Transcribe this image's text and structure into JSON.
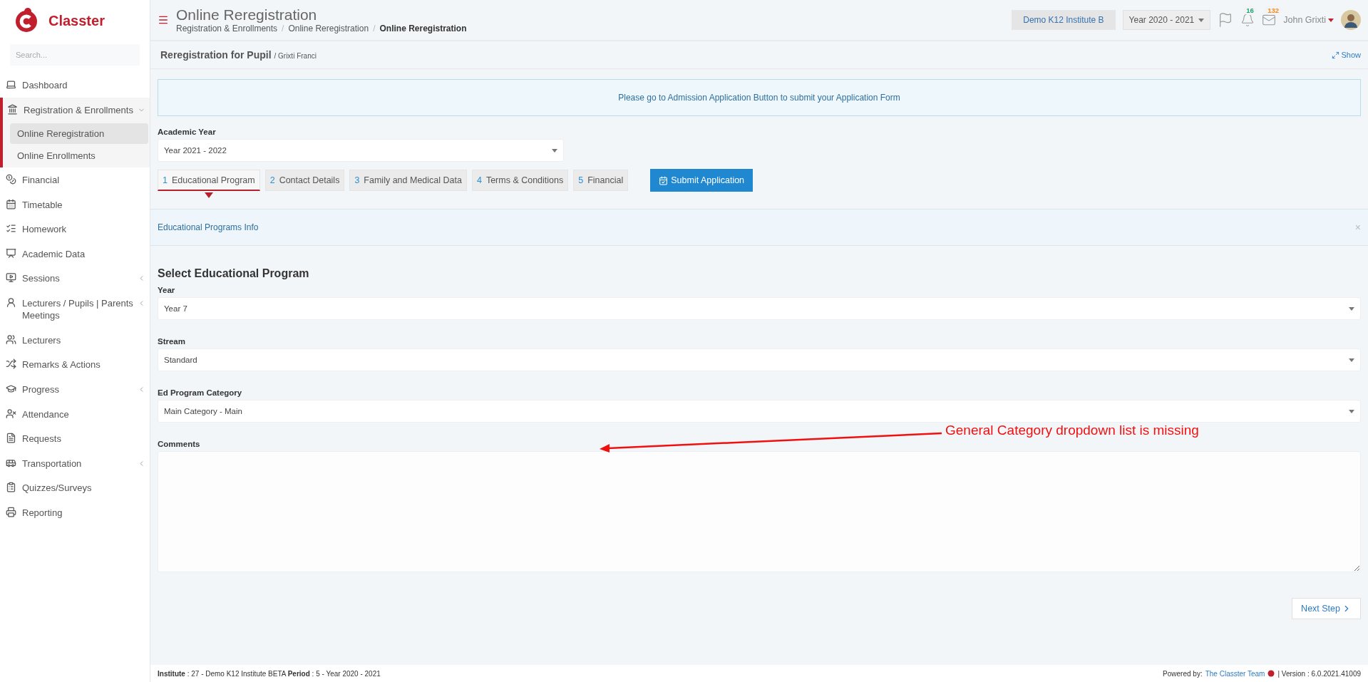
{
  "brand": {
    "name": "Classter"
  },
  "sidebar": {
    "search": {
      "placeholder": "Search..."
    },
    "items": [
      {
        "label": "Dashboard",
        "expandable": false,
        "expanded": false
      },
      {
        "label": "Registration & Enrollments",
        "expandable": true,
        "expanded": true,
        "children": [
          {
            "label": "Online Reregistration",
            "selected": true
          },
          {
            "label": "Online Enrollments",
            "selected": false
          }
        ]
      },
      {
        "label": "Financial",
        "expandable": false,
        "expanded": false
      },
      {
        "label": "Timetable",
        "expandable": false,
        "expanded": false
      },
      {
        "label": "Homework",
        "expandable": false,
        "expanded": false
      },
      {
        "label": "Academic Data",
        "expandable": false,
        "expanded": false
      },
      {
        "label": "Sessions",
        "expandable": true,
        "expanded": false
      },
      {
        "label": "Lecturers / Pupils | Parents Meetings",
        "expandable": true,
        "expanded": false
      },
      {
        "label": "Lecturers",
        "expandable": false,
        "expanded": false
      },
      {
        "label": "Remarks & Actions",
        "expandable": false,
        "expanded": false
      },
      {
        "label": "Progress",
        "expandable": true,
        "expanded": false
      },
      {
        "label": "Attendance",
        "expandable": false,
        "expanded": false
      },
      {
        "label": "Requests",
        "expandable": false,
        "expanded": false
      },
      {
        "label": "Transportation",
        "expandable": true,
        "expanded": false
      },
      {
        "label": "Quizzes/Surveys",
        "expandable": false,
        "expanded": false
      },
      {
        "label": "Reporting",
        "expandable": false,
        "expanded": false
      }
    ]
  },
  "header": {
    "title": "Online Reregistration",
    "breadcrumbs": [
      {
        "label": "Registration & Enrollments",
        "separator": "/"
      },
      {
        "label": "Online Reregistration",
        "separator": "/"
      },
      {
        "label": "Online Reregistration"
      }
    ],
    "institute": "Demo K12 Institute B",
    "year": "Year 2020 - 2021",
    "notifications": "16",
    "messages": "132",
    "user": "John Grixti"
  },
  "page": {
    "title": "Reregistration for Pupil",
    "subtitle": "/ Grixti Franci",
    "show_link": "Show"
  },
  "notice": "Please go to Admission Application Button to submit your Application Form",
  "academic_year": {
    "label": "Academic Year",
    "value": "Year 2021 - 2022"
  },
  "steps": [
    {
      "number": "1",
      "label": "Educational Program",
      "selected": true
    },
    {
      "number": "2",
      "label": "Contact Details",
      "selected": false
    },
    {
      "number": "3",
      "label": "Family and Medical Data",
      "selected": false
    },
    {
      "number": "4",
      "label": "Terms & Conditions",
      "selected": false
    },
    {
      "number": "5",
      "label": "Financial",
      "selected": false
    }
  ],
  "submit_button": "Submit Application",
  "info_panel": {
    "title": "Educational Programs Info",
    "close": "×"
  },
  "section_title": "Select Educational Program",
  "fields": [
    {
      "label": "Year",
      "value": "Year 7"
    },
    {
      "label": "Stream",
      "value": "Standard"
    },
    {
      "label": "Ed Program Category",
      "value": "Main Category - Main"
    }
  ],
  "comments": {
    "label": "Comments"
  },
  "next_button": "Next Step",
  "annotation": "General Category dropdown list is missing",
  "footer": {
    "info": "**Institute** : 27 - Demo K12 Institute BETA **Period** : 5 - Year 2020 - 2021",
    "powered_by": "Powered by:",
    "link": "The Classter Team",
    "version": "| Version : 6.0.2021.41009"
  }
}
